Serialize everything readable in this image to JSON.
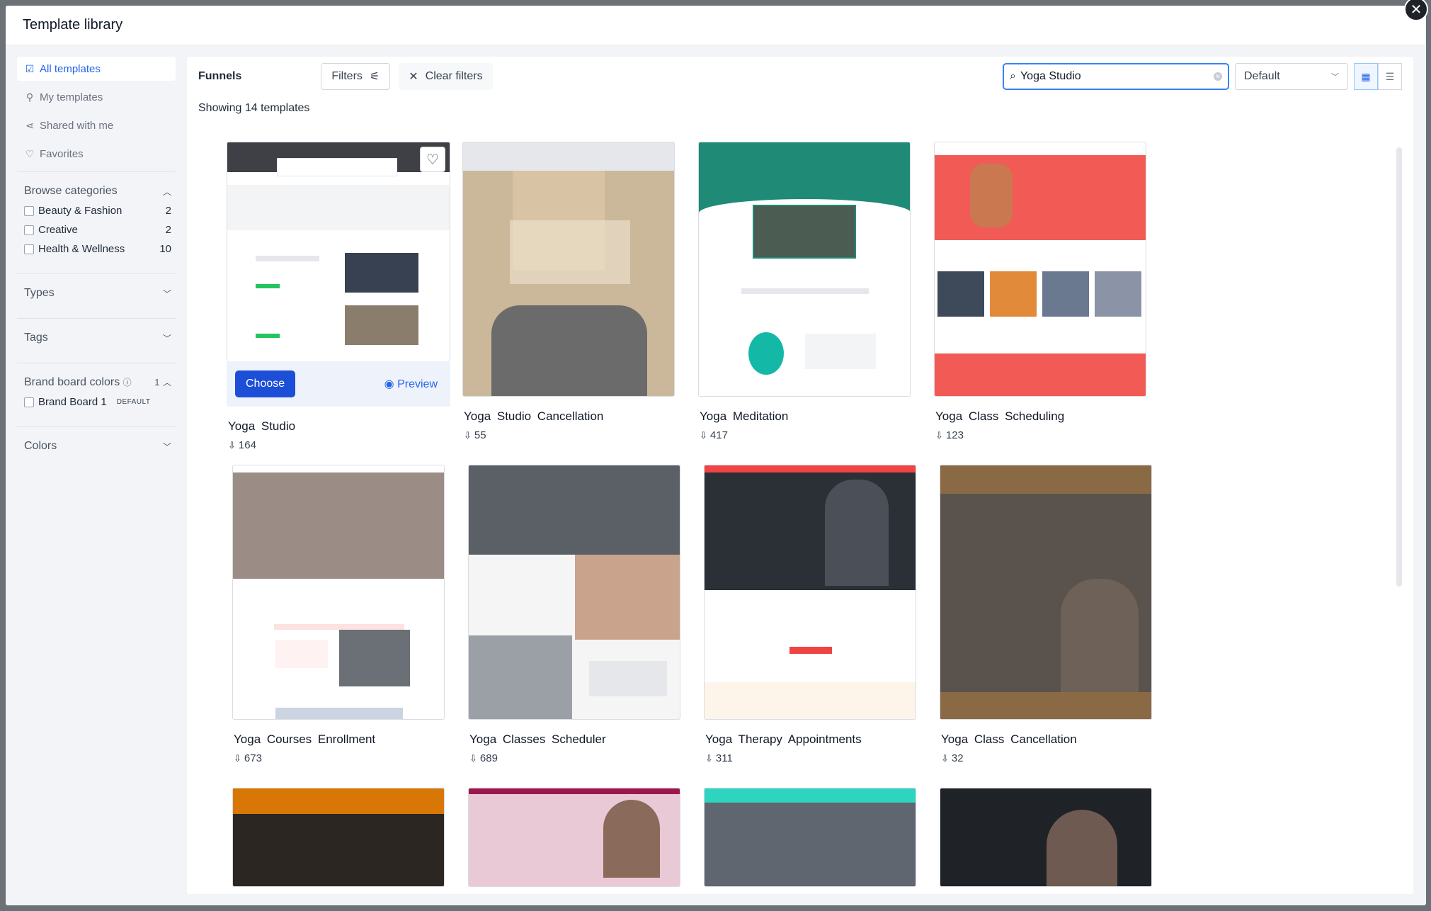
{
  "header": {
    "title": "Template library"
  },
  "sidebar": {
    "nav": [
      {
        "label": "All templates",
        "icon": "check-square-icon"
      },
      {
        "label": "My templates",
        "icon": "user-icon"
      },
      {
        "label": "Shared with me",
        "icon": "share-icon"
      },
      {
        "label": "Favorites",
        "icon": "heart-icon"
      }
    ],
    "browse": {
      "title": "Browse categories",
      "items": [
        {
          "label": "Beauty & Fashion",
          "count": "2"
        },
        {
          "label": "Creative",
          "count": "2"
        },
        {
          "label": "Health & Wellness",
          "count": "10"
        }
      ]
    },
    "types": "Types",
    "tags": "Tags",
    "brand": {
      "title": "Brand board colors",
      "count": "1",
      "item": "Brand Board 1",
      "badge": "DEFAULT"
    },
    "colors": "Colors"
  },
  "toolbar": {
    "label": "Funnels",
    "filters": "Filters",
    "clear": "Clear filters",
    "search": "Yoga Studio",
    "sort": "Default"
  },
  "showing": "Showing 14 templates",
  "card_actions": {
    "choose": "Choose",
    "preview": "Preview"
  },
  "templates": [
    {
      "name": "Yoga  Studio",
      "downloads": "164"
    },
    {
      "name": "Yoga  Studio  Cancellation",
      "downloads": "55"
    },
    {
      "name": "Yoga  Meditation",
      "downloads": "417"
    },
    {
      "name": "Yoga  Class Scheduling",
      "downloads": "123"
    },
    {
      "name": "Yoga  Courses Enrollment",
      "downloads": "673"
    },
    {
      "name": "Yoga  Classes Scheduler",
      "downloads": "689"
    },
    {
      "name": "Yoga  Therapy Appointments",
      "downloads": "311"
    },
    {
      "name": "Yoga  Class Cancellation",
      "downloads": "32"
    }
  ],
  "colors": {
    "accent": "#1d4ed8",
    "focus": "#3b82f6"
  }
}
